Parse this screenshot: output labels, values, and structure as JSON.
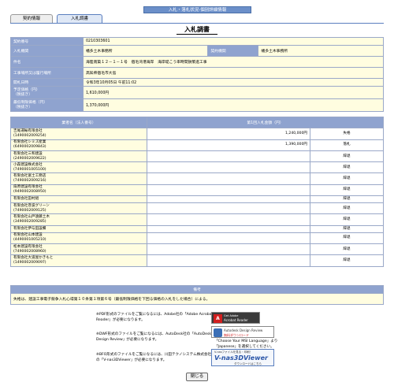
{
  "banner": "入札・落札状況-個別詳細情報",
  "tabs": {
    "contract": "契約情報",
    "bid": "入札調書"
  },
  "page_title": "入札調書",
  "info": {
    "contract_no_label": "契約番号",
    "contract_no": "0210303601",
    "bidding_org_label": "入札機関",
    "bidding_org": "幡多土木事務所",
    "contract_org_label": "契約機関",
    "contract_org": "幡多土木事務所",
    "matter_label": "件名",
    "matter": "海陸南築１２－１－１号　宿毛湾港海岸　海岸堤こう率時間損策進工事",
    "place_label": "工事場所又は履行場所",
    "place": "高知県宿毛市大島",
    "open_date_label": "開札日時",
    "open_date": "令和3年10月05日 午前11:02",
    "est_price_label": "予定価格（円）\n（税抜き）",
    "est_price": "1,610,000円",
    "min_price_label": "最低制限価格（円）\n（税抜き）",
    "min_price": "1,370,000円"
  },
  "bid_table": {
    "col_name": "業者名（法人番号）",
    "col_amount": "第1回入札金額（円）",
    "rows": [
      {
        "name": "吉尾運輸有限会社\n(1490002009254)",
        "amount": "1,240,000円",
        "result": "失格"
      },
      {
        "name": "有限会社シミズ産業\n(6490002009843)",
        "amount": "1,390,000円",
        "result": "落札"
      },
      {
        "name": "有限会社三和建設\n(2490002009622)",
        "amount": "",
        "result": "辞退"
      },
      {
        "name": "小森建設株式会社\n(7490001005100)",
        "amount": "",
        "result": "辞退"
      },
      {
        "name": "有限会社富士工務店\n(7490002009216)",
        "amount": "",
        "result": "辞退"
      },
      {
        "name": "扇原建設有限会社\n(9490002008950)",
        "amount": "",
        "result": "辞退"
      },
      {
        "name": "有限会社田村組",
        "amount": "",
        "result": "辞退"
      },
      {
        "name": "有限会社巻波グリーン\n(7490002009125)",
        "amount": "",
        "result": "辞退"
      },
      {
        "name": "有限会社山戸遠藤土木\n(3490002009285)",
        "amount": "",
        "result": "辞退"
      },
      {
        "name": "有限会社伊与田設備",
        "amount": "",
        "result": "辞退"
      },
      {
        "name": "有限会社山本建設\n(4490001005210)",
        "amount": "",
        "result": "辞退"
      },
      {
        "name": "松本建設有限会社\n(7490002008960)",
        "amount": "",
        "result": "辞退"
      },
      {
        "name": "有限会社大道屋かきもと\n(1490002009097)",
        "amount": "",
        "result": "辞退"
      }
    ]
  },
  "remarks": {
    "header": "備考",
    "text": "失格は、建設工事電子競争入札心得第１０条第１項第６号（最低制限価格を下回る価格の入札をした場合）による。"
  },
  "notes": {
    "pdf": "※PDF形式のファイルをご覧になるには、Adobe社の「Adobe Acrobat Reader」が必要になります。",
    "dwf": "※DWF形式のファイルをご覧になるには、AutoDesk社の「AutoDesk Design Review」が必要になります。",
    "dwf_extra": "「Choose Your MSI Language」より「Japanese」を選択してください。",
    "bfo": "※BFO形式のファイルをご覧になるには、川田テクノシステム株式会社の「V-nas3DViewer」が必要になります。"
  },
  "badges": {
    "adobe_small": "Get Adobe",
    "adobe_big": "Acrobat Reader",
    "dwg_title": "Autodesk Design Review",
    "dwg_sub": "無料ダウンロード",
    "nas_top": "V-nasファイルを見る・印刷！",
    "nas_title": "V-nas3DViewer",
    "nas_sub": "ダウンロードはこちら"
  },
  "close_label": "閉じる"
}
